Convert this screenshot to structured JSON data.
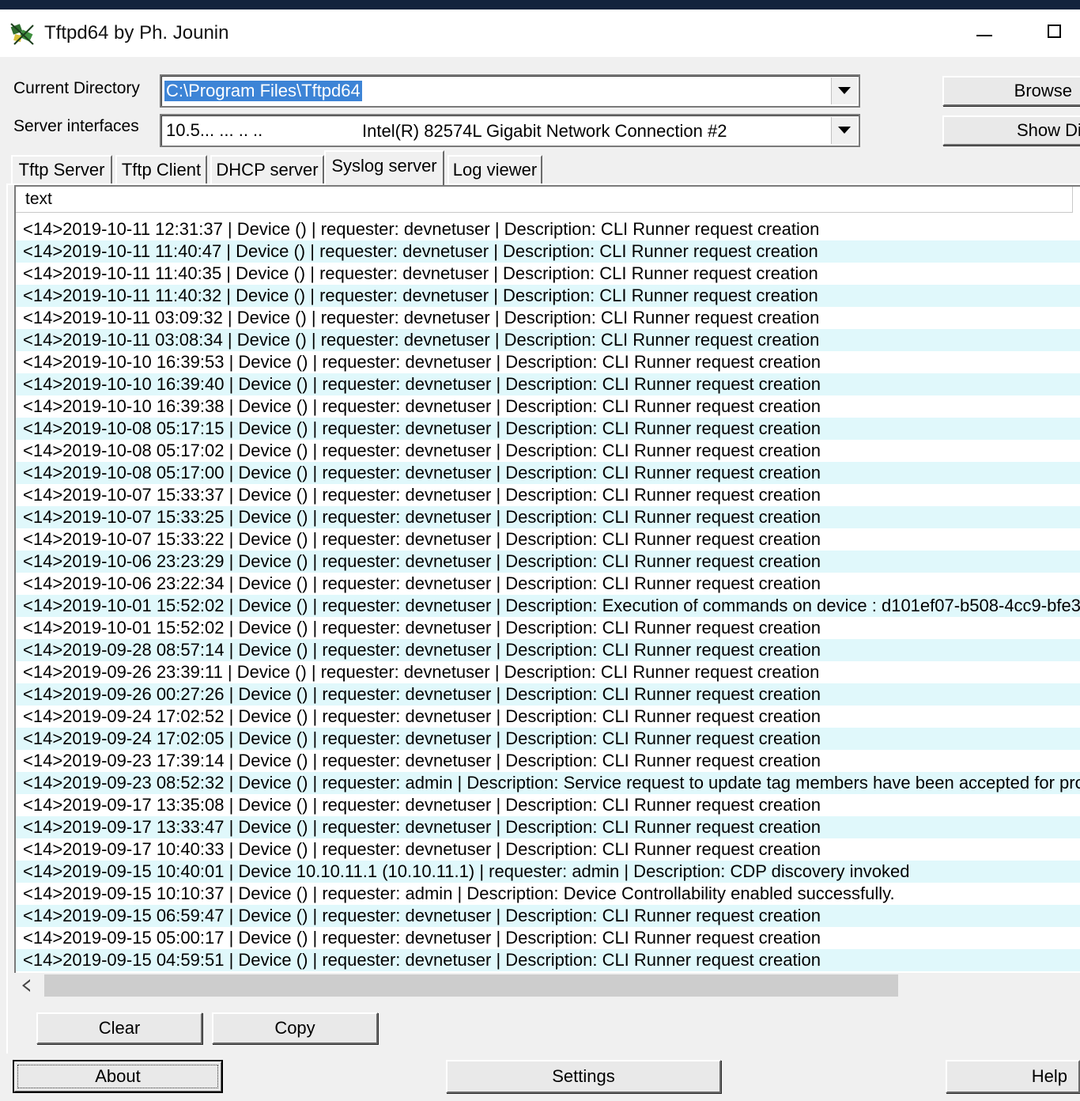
{
  "window": {
    "title": "Tftpd64 by Ph. Jounin"
  },
  "top": {
    "current_directory_label": "Current Directory",
    "current_directory_value": "C:\\Program Files\\Tftpd64",
    "server_interfaces_label": "Server interfaces",
    "server_interface_ip": "10.5...  ... .. ..",
    "server_interface_name": "Intel(R) 82574L Gigabit Network Connection #2",
    "browse_label": "Browse",
    "show_dir_label": "Show Di"
  },
  "tabs": [
    {
      "label": "Tftp Server"
    },
    {
      "label": "Tftp Client"
    },
    {
      "label": "DHCP server"
    },
    {
      "label": "Syslog server",
      "active": true
    },
    {
      "label": "Log viewer"
    }
  ],
  "log": {
    "column_header": "text",
    "rows": [
      "<14>2019-10-11 12:31:37 | Device  () | requester: devnetuser | Description: CLI Runner request creation",
      "<14>2019-10-11 11:40:47 | Device  () | requester: devnetuser | Description: CLI Runner request creation",
      "<14>2019-10-11 11:40:35 | Device  () | requester: devnetuser | Description: CLI Runner request creation",
      "<14>2019-10-11 11:40:32 | Device  () | requester: devnetuser | Description: CLI Runner request creation",
      "<14>2019-10-11 03:09:32 | Device  () | requester: devnetuser | Description: CLI Runner request creation",
      "<14>2019-10-11 03:08:34 | Device  () | requester: devnetuser | Description: CLI Runner request creation",
      "<14>2019-10-10 16:39:53 | Device  () | requester: devnetuser | Description: CLI Runner request creation",
      "<14>2019-10-10 16:39:40 | Device  () | requester: devnetuser | Description: CLI Runner request creation",
      "<14>2019-10-10 16:39:38 | Device  () | requester: devnetuser | Description: CLI Runner request creation",
      "<14>2019-10-08 05:17:15 | Device  () | requester: devnetuser | Description: CLI Runner request creation",
      "<14>2019-10-08 05:17:02 | Device  () | requester: devnetuser | Description: CLI Runner request creation",
      "<14>2019-10-08 05:17:00 | Device  () | requester: devnetuser | Description: CLI Runner request creation",
      "<14>2019-10-07 15:33:37 | Device  () | requester: devnetuser | Description: CLI Runner request creation",
      "<14>2019-10-07 15:33:25 | Device  () | requester: devnetuser | Description: CLI Runner request creation",
      "<14>2019-10-07 15:33:22 | Device  () | requester: devnetuser | Description: CLI Runner request creation",
      "<14>2019-10-06 23:23:29 | Device  () | requester: devnetuser | Description: CLI Runner request creation",
      "<14>2019-10-06 23:22:34 | Device  () | requester: devnetuser | Description: CLI Runner request creation",
      "<14>2019-10-01 15:52:02 | Device  () | requester: devnetuser | Description: Execution of commands on device : d101ef07-b508-4cc9-bfe3-...",
      "<14>2019-10-01 15:52:02 | Device  () | requester: devnetuser | Description: CLI Runner request creation",
      "<14>2019-09-28 08:57:14 | Device  () | requester: devnetuser | Description: CLI Runner request creation",
      "<14>2019-09-26 23:39:11 | Device  () | requester: devnetuser | Description: CLI Runner request creation",
      "<14>2019-09-26 00:27:26 | Device  () | requester: devnetuser | Description: CLI Runner request creation",
      "<14>2019-09-24 17:02:52 | Device  () | requester: devnetuser | Description: CLI Runner request creation",
      "<14>2019-09-24 17:02:05 | Device  () | requester: devnetuser | Description: CLI Runner request creation",
      "<14>2019-09-23 17:39:14 | Device  () | requester: devnetuser | Description: CLI Runner request creation",
      "<14>2019-09-23 08:52:32 | Device  () | requester: admin | Description: Service request to update tag members have been accepted for pro...",
      "<14>2019-09-17 13:35:08 | Device  () | requester: devnetuser | Description: CLI Runner request creation",
      "<14>2019-09-17 13:33:47 | Device  () | requester: devnetuser | Description: CLI Runner request creation",
      "<14>2019-09-17 10:40:33 | Device  () | requester: devnetuser | Description: CLI Runner request creation",
      "<14>2019-09-15 10:40:01 | Device 10.10.11.1 (10.10.11.1) | requester: admin | Description: CDP discovery invoked",
      "<14>2019-09-15 10:10:37 | Device  () | requester: admin | Description: Device Controllability enabled successfully.",
      "<14>2019-09-15 06:59:47 | Device  () | requester: devnetuser | Description: CLI Runner request creation",
      "<14>2019-09-15 05:00:17 | Device  () | requester: devnetuser | Description: CLI Runner request creation",
      "<14>2019-09-15 04:59:51 | Device  () | requester: devnetuser | Description: CLI Runner request creation"
    ]
  },
  "actions": {
    "clear_label": "Clear",
    "copy_label": "Copy"
  },
  "footer": {
    "about_label": "About",
    "settings_label": "Settings",
    "help_label": "Help"
  },
  "colors": {
    "alt_row": "#e0f8fb",
    "selection": "#3d84d6",
    "top_strip": "#13233d"
  }
}
